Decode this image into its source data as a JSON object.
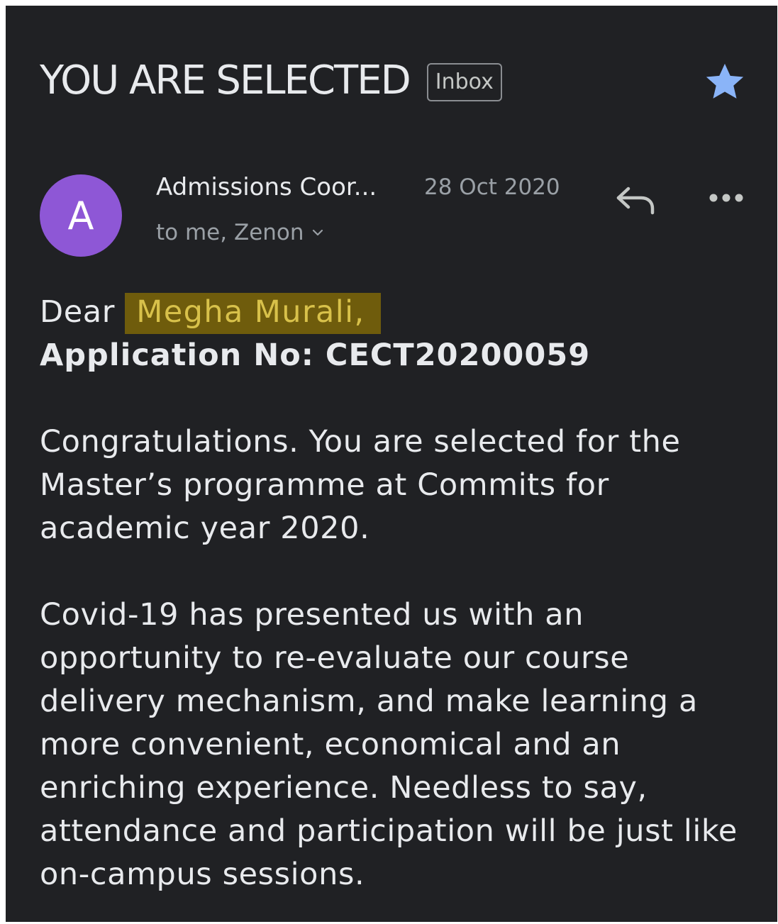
{
  "email": {
    "subject": "YOU ARE SELECTED",
    "label": "Inbox",
    "starred": true,
    "star_color": "#8ab4f8",
    "avatar": {
      "letter": "A",
      "color": "#8e57d6"
    },
    "sender": "Admissions Coor...",
    "date": "28 Oct 2020",
    "recipients": "to me, Zenon",
    "icons": {
      "star": "star-icon",
      "reply": "reply-icon",
      "more": "more-horizontal-icon",
      "expand": "chevron-down-icon"
    },
    "body": {
      "salutation": "Dear",
      "recipient_name": "Megha Murali,",
      "highlight_color": "#6f5c0c",
      "application_line": "Application No: CECT20200059",
      "paragraph1": "Congratulations. You are selected for the Master’s programme at Commits for academic year 2020.",
      "paragraph2": "Covid-19 has presented us with an opportunity to re-evaluate our course delivery mechanism, and make learning a more convenient, economical and an enriching experience. Needless to say, attendance and participation will be just like on-campus sessions."
    }
  }
}
